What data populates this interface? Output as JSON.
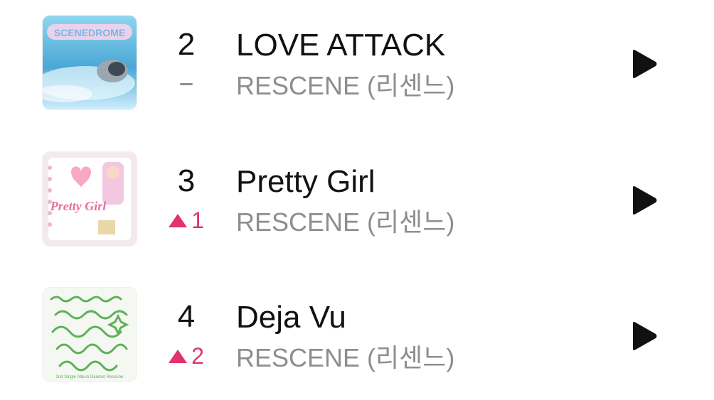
{
  "chart": {
    "items": [
      {
        "rank": "2",
        "change": "–",
        "change_type": "same",
        "title": "LOVE ATTACK",
        "artist": "RESCENE (리센느)",
        "cover_text": "SCENEDROME",
        "cover_colors": [
          "#7ec8e6",
          "#3f9fcf",
          "#e8f6ff"
        ]
      },
      {
        "rank": "3",
        "change": "1",
        "change_type": "up",
        "title": "Pretty Girl",
        "artist": "RESCENE (리센느)",
        "cover_text": "Pretty Girl",
        "cover_colors": [
          "#f6cbd8",
          "#ffffff",
          "#e8f0ff"
        ]
      },
      {
        "rank": "4",
        "change": "2",
        "change_type": "up",
        "title": "Deja Vu",
        "artist": "RESCENE (리센느)",
        "cover_text": "2nd Single Album Dearest Rescene",
        "cover_colors": [
          "#f4f7f1",
          "#5fb158",
          "#9ad08b"
        ]
      }
    ]
  },
  "icons": {
    "play": "play-icon",
    "rank_up": "up-arrow-icon",
    "rank_same": "dash-icon"
  },
  "colors": {
    "rank_up": "#e0336f",
    "muted_text": "#8e8e8e",
    "primary_text": "#111111",
    "play_icon": "#111111"
  }
}
